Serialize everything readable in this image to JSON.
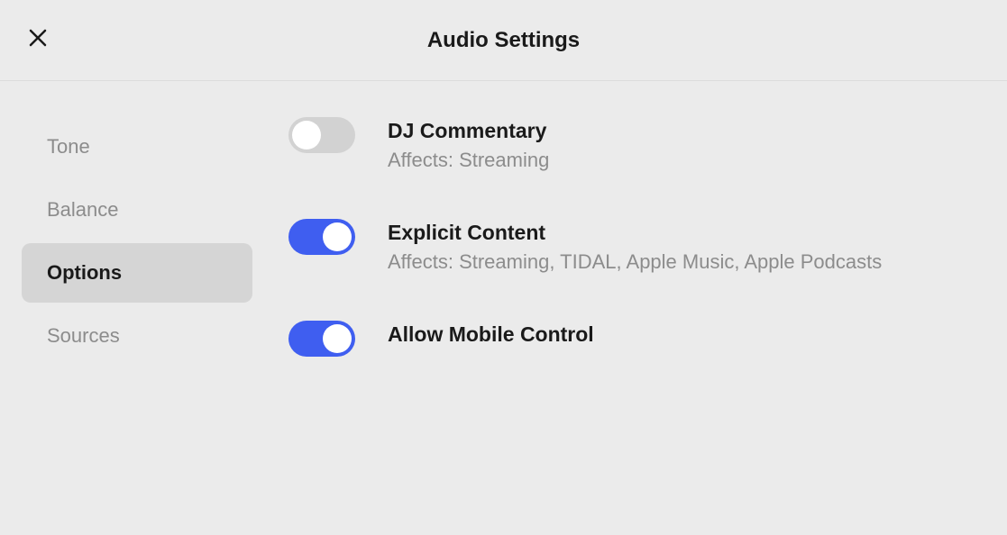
{
  "header": {
    "title": "Audio Settings"
  },
  "sidebar": {
    "items": [
      {
        "label": "Tone",
        "active": false
      },
      {
        "label": "Balance",
        "active": false
      },
      {
        "label": "Options",
        "active": true
      },
      {
        "label": "Sources",
        "active": false
      }
    ]
  },
  "options": [
    {
      "title": "DJ Commentary",
      "subtitle": "Affects: Streaming",
      "enabled": false
    },
    {
      "title": "Explicit Content",
      "subtitle": "Affects: Streaming, TIDAL, Apple Music, Apple Podcasts",
      "enabled": true
    },
    {
      "title": "Allow Mobile Control",
      "subtitle": "",
      "enabled": true
    }
  ]
}
